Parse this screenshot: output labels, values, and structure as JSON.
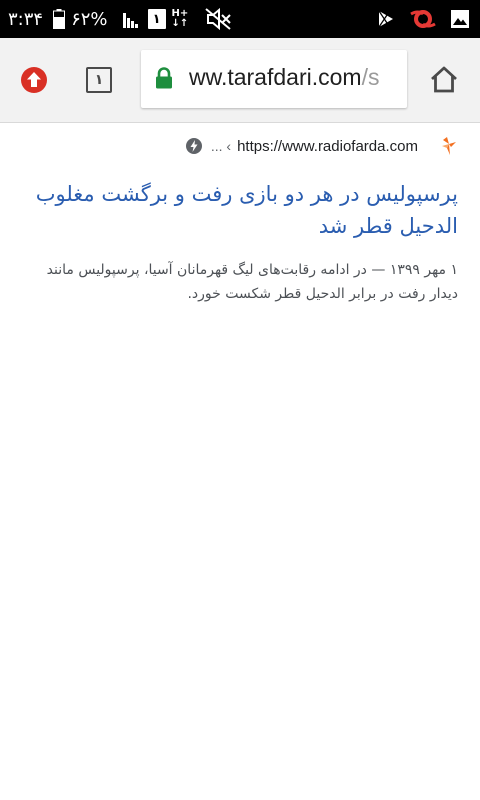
{
  "status_bar": {
    "time": "۳:۳۴",
    "battery_pct": "۶۲%",
    "sim_slot": "۱",
    "network_top": "H+",
    "network_bottom": "↓↑",
    "icons": [
      "battery-icon",
      "signal-icon",
      "sim-icon",
      "mute-icon",
      "play-store-icon",
      "app-notification-icon",
      "gallery-icon"
    ]
  },
  "toolbar": {
    "tab_count": "۱",
    "url_visible": "ww.tarafdari.com",
    "url_faded": "/s",
    "lock_color": "#1e8e3e",
    "update_color": "#d93025"
  },
  "result": {
    "source_url": "https://www.radiofarda.com",
    "source_dots": "... ‹",
    "title": "پرسپولیس در هر دو بازی رفت و برگشت مغلوب الدحیل قطر شد",
    "snippet": "۱ مهر ۱۳۹۹ — در ادامه رقابت‌های لیگ قهرمانان آسیا، پرسپولیس مانند دیدار رفت در برابر الدحیل قطر شکست خورد.",
    "title_color": "#2a5db0"
  }
}
